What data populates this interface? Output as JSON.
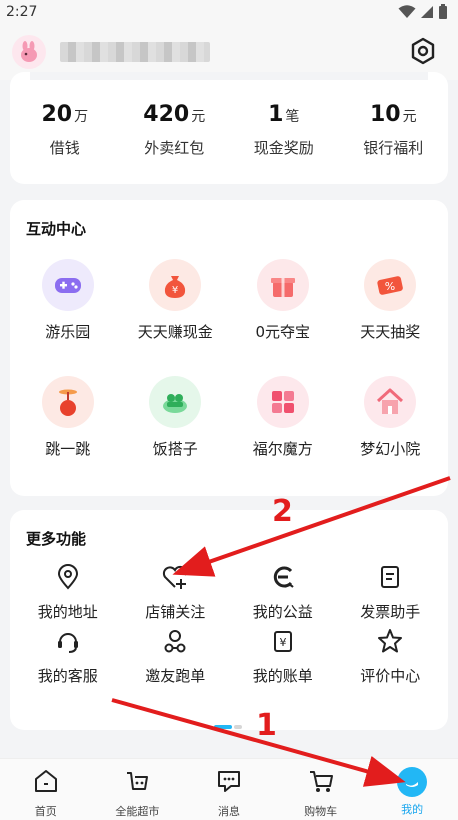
{
  "status_bar": {
    "time": "2:27"
  },
  "wallet": {
    "items": [
      {
        "value": "20",
        "unit": "万",
        "label": "借钱"
      },
      {
        "value": "420",
        "unit": "元",
        "label": "外卖红包"
      },
      {
        "value": "1",
        "unit": "笔",
        "label": "现金奖励"
      },
      {
        "value": "10",
        "unit": "元",
        "label": "银行福利"
      }
    ]
  },
  "interaction_center": {
    "title": "互动中心",
    "items": [
      {
        "label": "游乐园",
        "icon": "gamepad-icon",
        "color": "#8b6df0"
      },
      {
        "label": "天天赚现金",
        "icon": "money-bag-icon",
        "color": "#f2553c"
      },
      {
        "label": "0元夺宝",
        "icon": "gift-box-icon",
        "color": "#f56b6b"
      },
      {
        "label": "天天抽奖",
        "icon": "coupon-icon",
        "color": "#f2553c"
      },
      {
        "label": "跳一跳",
        "icon": "propeller-icon",
        "color": "#f2553c"
      },
      {
        "label": "饭搭子",
        "icon": "people-icon",
        "color": "#3cc46a"
      },
      {
        "label": "福尔魔方",
        "icon": "cube-icon",
        "color": "#f0506e"
      },
      {
        "label": "梦幻小院",
        "icon": "house-icon",
        "color": "#f06a7a"
      }
    ]
  },
  "more_functions": {
    "title": "更多功能",
    "items": [
      {
        "label": "我的地址",
        "icon": "location-icon"
      },
      {
        "label": "店铺关注",
        "icon": "heart-plus-icon"
      },
      {
        "label": "我的公益",
        "icon": "charity-icon"
      },
      {
        "label": "发票助手",
        "icon": "invoice-icon"
      },
      {
        "label": "我的客服",
        "icon": "headset-icon"
      },
      {
        "label": "邀友跑单",
        "icon": "rider-icon"
      },
      {
        "label": "我的账单",
        "icon": "bill-icon"
      },
      {
        "label": "评价中心",
        "icon": "star-icon"
      }
    ]
  },
  "bottom_nav": {
    "items": [
      {
        "label": "首页",
        "icon": "home-icon",
        "active": false
      },
      {
        "label": "全能超市",
        "icon": "basket-icon",
        "active": false
      },
      {
        "label": "消息",
        "icon": "message-icon",
        "active": false
      },
      {
        "label": "购物车",
        "icon": "cart-icon",
        "active": false
      },
      {
        "label": "我的",
        "icon": "profile-icon",
        "active": true
      }
    ]
  },
  "annotations": {
    "step1": "1",
    "step2": "2"
  },
  "colors": {
    "accent": "#17a5ee",
    "arrow": "#e21d1d"
  }
}
